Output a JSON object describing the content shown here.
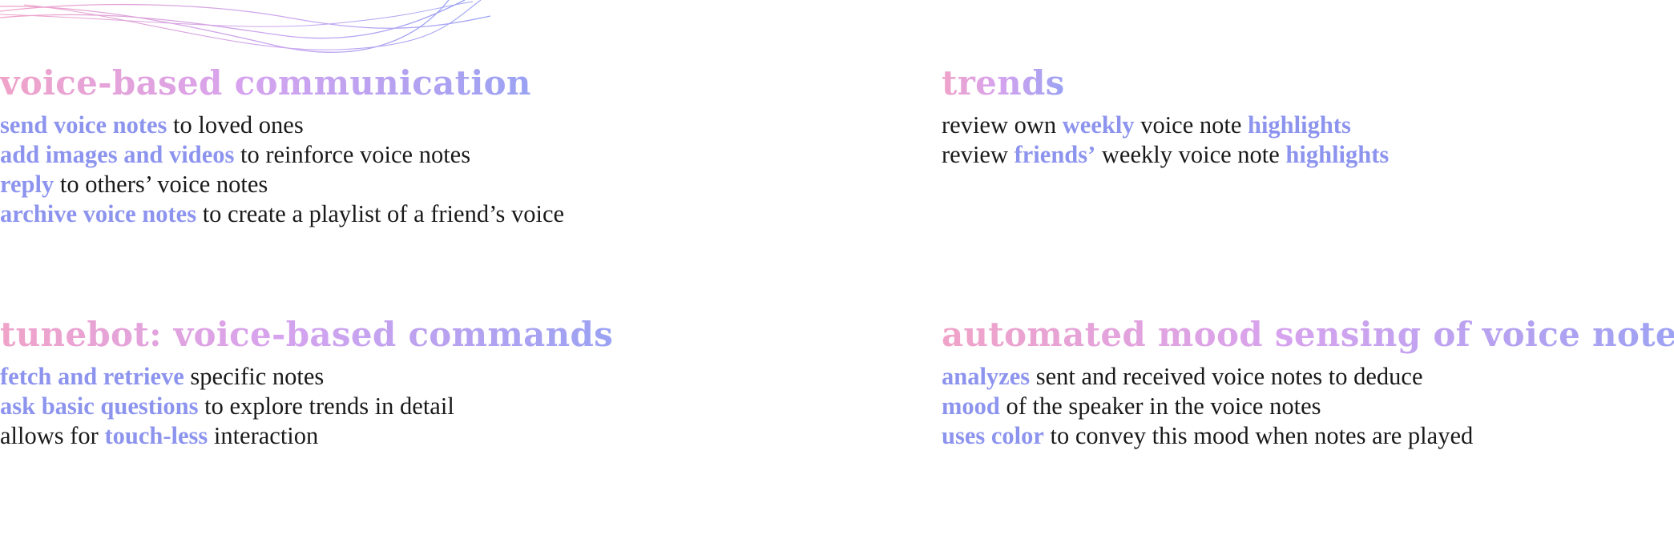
{
  "colors": {
    "accent": "#8d94ee",
    "heading_gradient": [
      "#f0a3c8",
      "#d7a3ee",
      "#9aa2f3"
    ],
    "text": "#1a1a1a",
    "background": "#ffffff",
    "decoration_lines": [
      "#f0a3c8",
      "#b7a8f0"
    ]
  },
  "sections": [
    {
      "heading": "voice-based communication",
      "lines": [
        [
          {
            "text": "send voice notes",
            "hl": true
          },
          {
            "text": " to loved ones",
            "hl": false
          }
        ],
        [
          {
            "text": "add images and videos",
            "hl": true
          },
          {
            "text": " to reinforce voice notes",
            "hl": false
          }
        ],
        [
          {
            "text": "reply",
            "hl": true
          },
          {
            "text": " to others’ voice notes",
            "hl": false
          }
        ],
        [
          {
            "text": "archive voice notes",
            "hl": true
          },
          {
            "text": " to create a playlist of a friend’s voice",
            "hl": false
          }
        ]
      ]
    },
    {
      "heading": "trends",
      "lines": [
        [
          {
            "text": "review own ",
            "hl": false
          },
          {
            "text": "weekly",
            "hl": true
          },
          {
            "text": " voice note ",
            "hl": false
          },
          {
            "text": "highlights",
            "hl": true
          }
        ],
        [
          {
            "text": "review ",
            "hl": false
          },
          {
            "text": "friends’",
            "hl": true
          },
          {
            "text": " weekly voice note ",
            "hl": false
          },
          {
            "text": "highlights",
            "hl": true
          }
        ]
      ]
    },
    {
      "heading": "tunebot: voice-based commands",
      "lines": [
        [
          {
            "text": "fetch and retrieve",
            "hl": true
          },
          {
            "text": " specific notes",
            "hl": false
          }
        ],
        [
          {
            "text": "ask basic questions",
            "hl": true
          },
          {
            "text": " to explore trends in detail",
            "hl": false
          }
        ],
        [
          {
            "text": "allows for ",
            "hl": false
          },
          {
            "text": "touch-less",
            "hl": true
          },
          {
            "text": " interaction",
            "hl": false
          }
        ]
      ]
    },
    {
      "heading": "automated mood sensing of voice notes",
      "lines": [
        [
          {
            "text": "analyzes",
            "hl": true
          },
          {
            "text": " sent and received voice notes to deduce",
            "hl": false
          }
        ],
        [
          {
            "text": "mood",
            "hl": true
          },
          {
            "text": " of the speaker in the voice notes",
            "hl": false
          }
        ],
        [
          {
            "text": "uses color",
            "hl": true
          },
          {
            "text": " to convey this mood when notes are played",
            "hl": false
          }
        ]
      ]
    }
  ]
}
